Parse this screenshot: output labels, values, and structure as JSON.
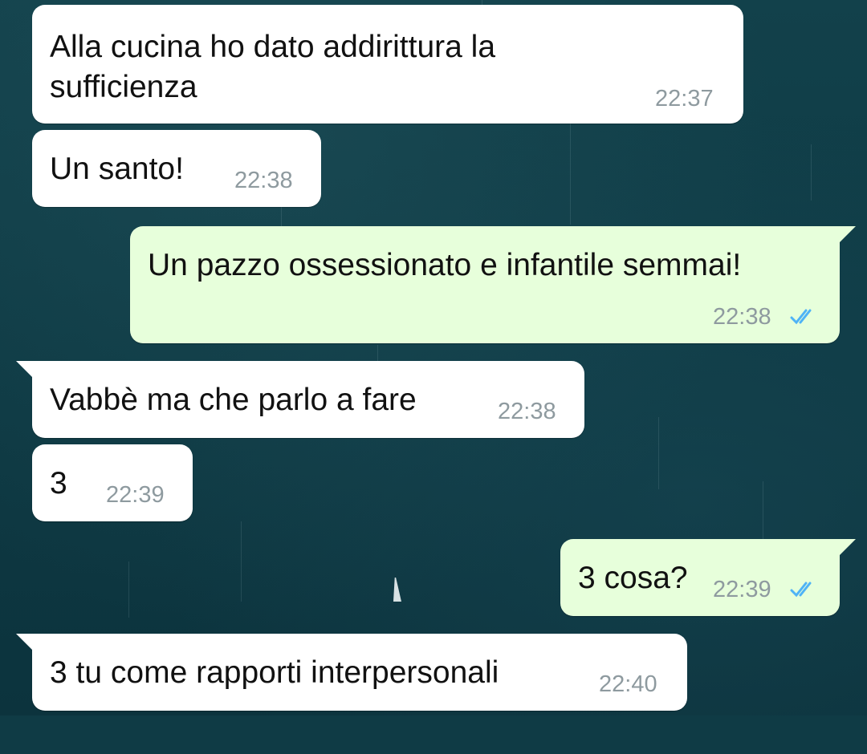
{
  "chat": {
    "messages": [
      {
        "direction": "incoming",
        "text_line1": "Alla cucina ho dato addirittura la",
        "text_line2": "sufficienza",
        "time": "22:37"
      },
      {
        "direction": "incoming",
        "text": "Un santo!",
        "time": "22:38"
      },
      {
        "direction": "outgoing",
        "text": "Un pazzo ossessionato e infantile semmai!",
        "time": "22:38",
        "status": "read",
        "status_icon": "double-check-icon"
      },
      {
        "direction": "incoming",
        "text": "Vabbè ma che parlo a fare",
        "time": "22:38"
      },
      {
        "direction": "incoming",
        "text": "3",
        "time": "22:39"
      },
      {
        "direction": "outgoing",
        "text": "3 cosa?",
        "time": "22:39",
        "status": "read",
        "status_icon": "double-check-icon"
      },
      {
        "direction": "incoming",
        "text": "3 tu come rapporti interpersonali",
        "time": "22:40"
      }
    ]
  },
  "colors": {
    "incoming_bubble": "#ffffff",
    "outgoing_bubble": "#e7ffdb",
    "timestamp": "#8e9a9f",
    "read_ticks": "#4fb3f6",
    "wallpaper": "#0f3b45"
  }
}
